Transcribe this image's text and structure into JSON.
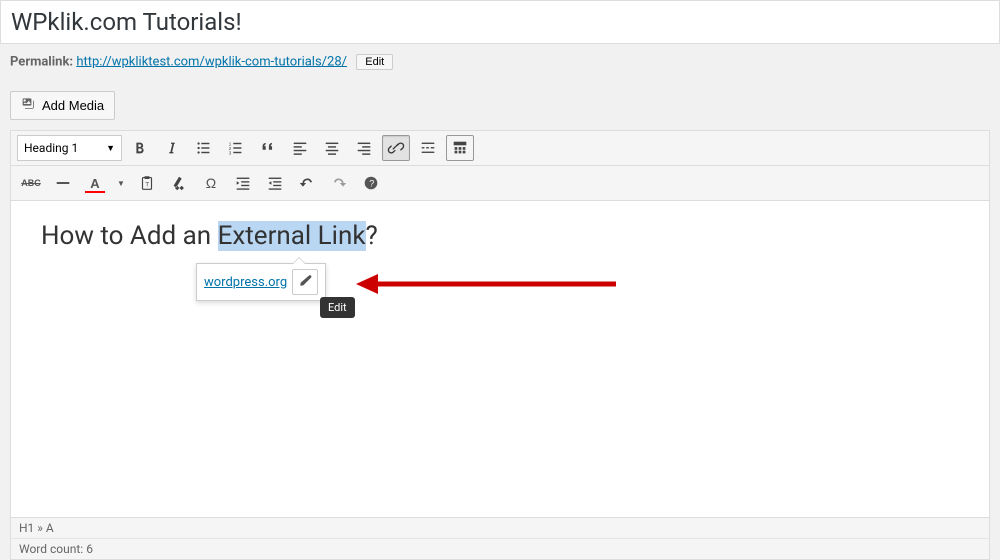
{
  "title_input": "WPklik.com Tutorials!",
  "permalink": {
    "label": "Permalink:",
    "base_url": "http://wpkliktest.com/",
    "slug": "wpklik-com-tutorials",
    "suffix": "/28/",
    "edit_button": "Edit"
  },
  "add_media_button": "Add Media",
  "format_dropdown": "Heading 1",
  "editor_content": {
    "before": "How to Add an ",
    "selected": "External Link",
    "after": "?"
  },
  "link_popup": {
    "url_text": "wordpress.org",
    "tooltip": "Edit"
  },
  "breadcrumb": "H1 » A",
  "word_count_label": "Word count:",
  "word_count_value": "6"
}
